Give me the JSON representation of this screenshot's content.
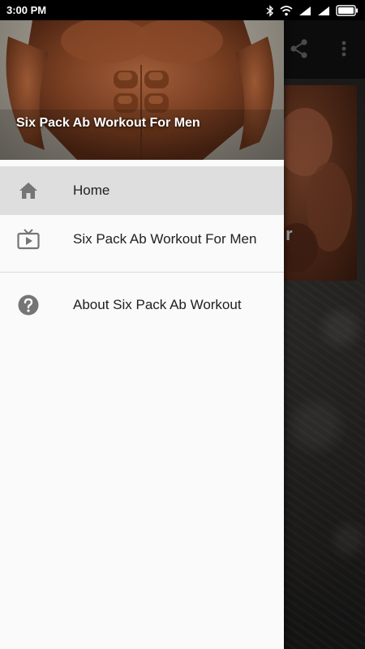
{
  "status_bar": {
    "time": "3:00 PM",
    "icons": [
      "bluetooth-icon",
      "wifi-icon",
      "signal-icon",
      "signal-icon",
      "battery-icon"
    ]
  },
  "background_app": {
    "toolbar_icons": [
      "share-icon",
      "more-vert-icon"
    ],
    "card_text_fragment": "r"
  },
  "drawer": {
    "header_title": "Six Pack Ab Workout For Men",
    "items": [
      {
        "label": "Home",
        "icon": "home-icon",
        "selected": true
      },
      {
        "label": "Six Pack Ab Workout For Men",
        "icon": "tv-play-icon",
        "selected": false
      },
      {
        "label": "About Six Pack Ab Workout",
        "icon": "help-icon",
        "selected": false
      }
    ]
  },
  "colors": {
    "drawer_bg": "#fafafa",
    "selected_item_bg": "#dedede",
    "icon_gray": "#757575",
    "status_bar_bg": "#000000"
  }
}
